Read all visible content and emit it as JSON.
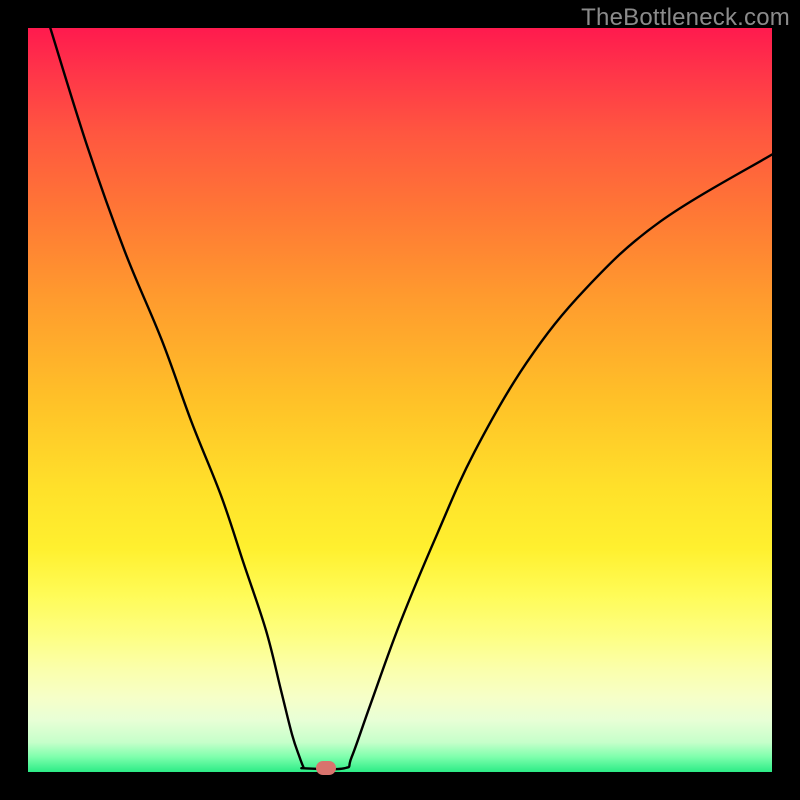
{
  "watermark": "TheBottleneck.com",
  "chart_data": {
    "type": "line",
    "title": "",
    "xlabel": "",
    "ylabel": "",
    "xlim": [
      0,
      100
    ],
    "ylim": [
      0,
      100
    ],
    "grid": false,
    "legend": false,
    "gradient_bands": [
      {
        "pct": 0,
        "color": "#ff1a4e"
      },
      {
        "pct": 25,
        "color": "#ff7835"
      },
      {
        "pct": 50,
        "color": "#ffc128"
      },
      {
        "pct": 75,
        "color": "#fffb56"
      },
      {
        "pct": 90,
        "color": "#f6ffc8"
      },
      {
        "pct": 100,
        "color": "#2cec86"
      }
    ],
    "series": [
      {
        "name": "bottleneck-curve",
        "color": "#000000",
        "x": [
          3,
          8,
          13,
          18,
          22,
          26,
          29,
          32,
          34,
          35.5,
          36.5,
          37,
          37.2,
          42.5,
          43.5,
          46,
          50,
          55,
          60,
          67,
          75,
          85,
          100
        ],
        "y": [
          100,
          84,
          70,
          58,
          47,
          37,
          28,
          19,
          11,
          5,
          2,
          0.7,
          0.5,
          0.5,
          2,
          9,
          20,
          32,
          43,
          55,
          65,
          74,
          83
        ]
      }
    ],
    "marker": {
      "x": 40,
      "y": 0.5,
      "label": "optimal-point",
      "color": "#d9736d"
    }
  }
}
